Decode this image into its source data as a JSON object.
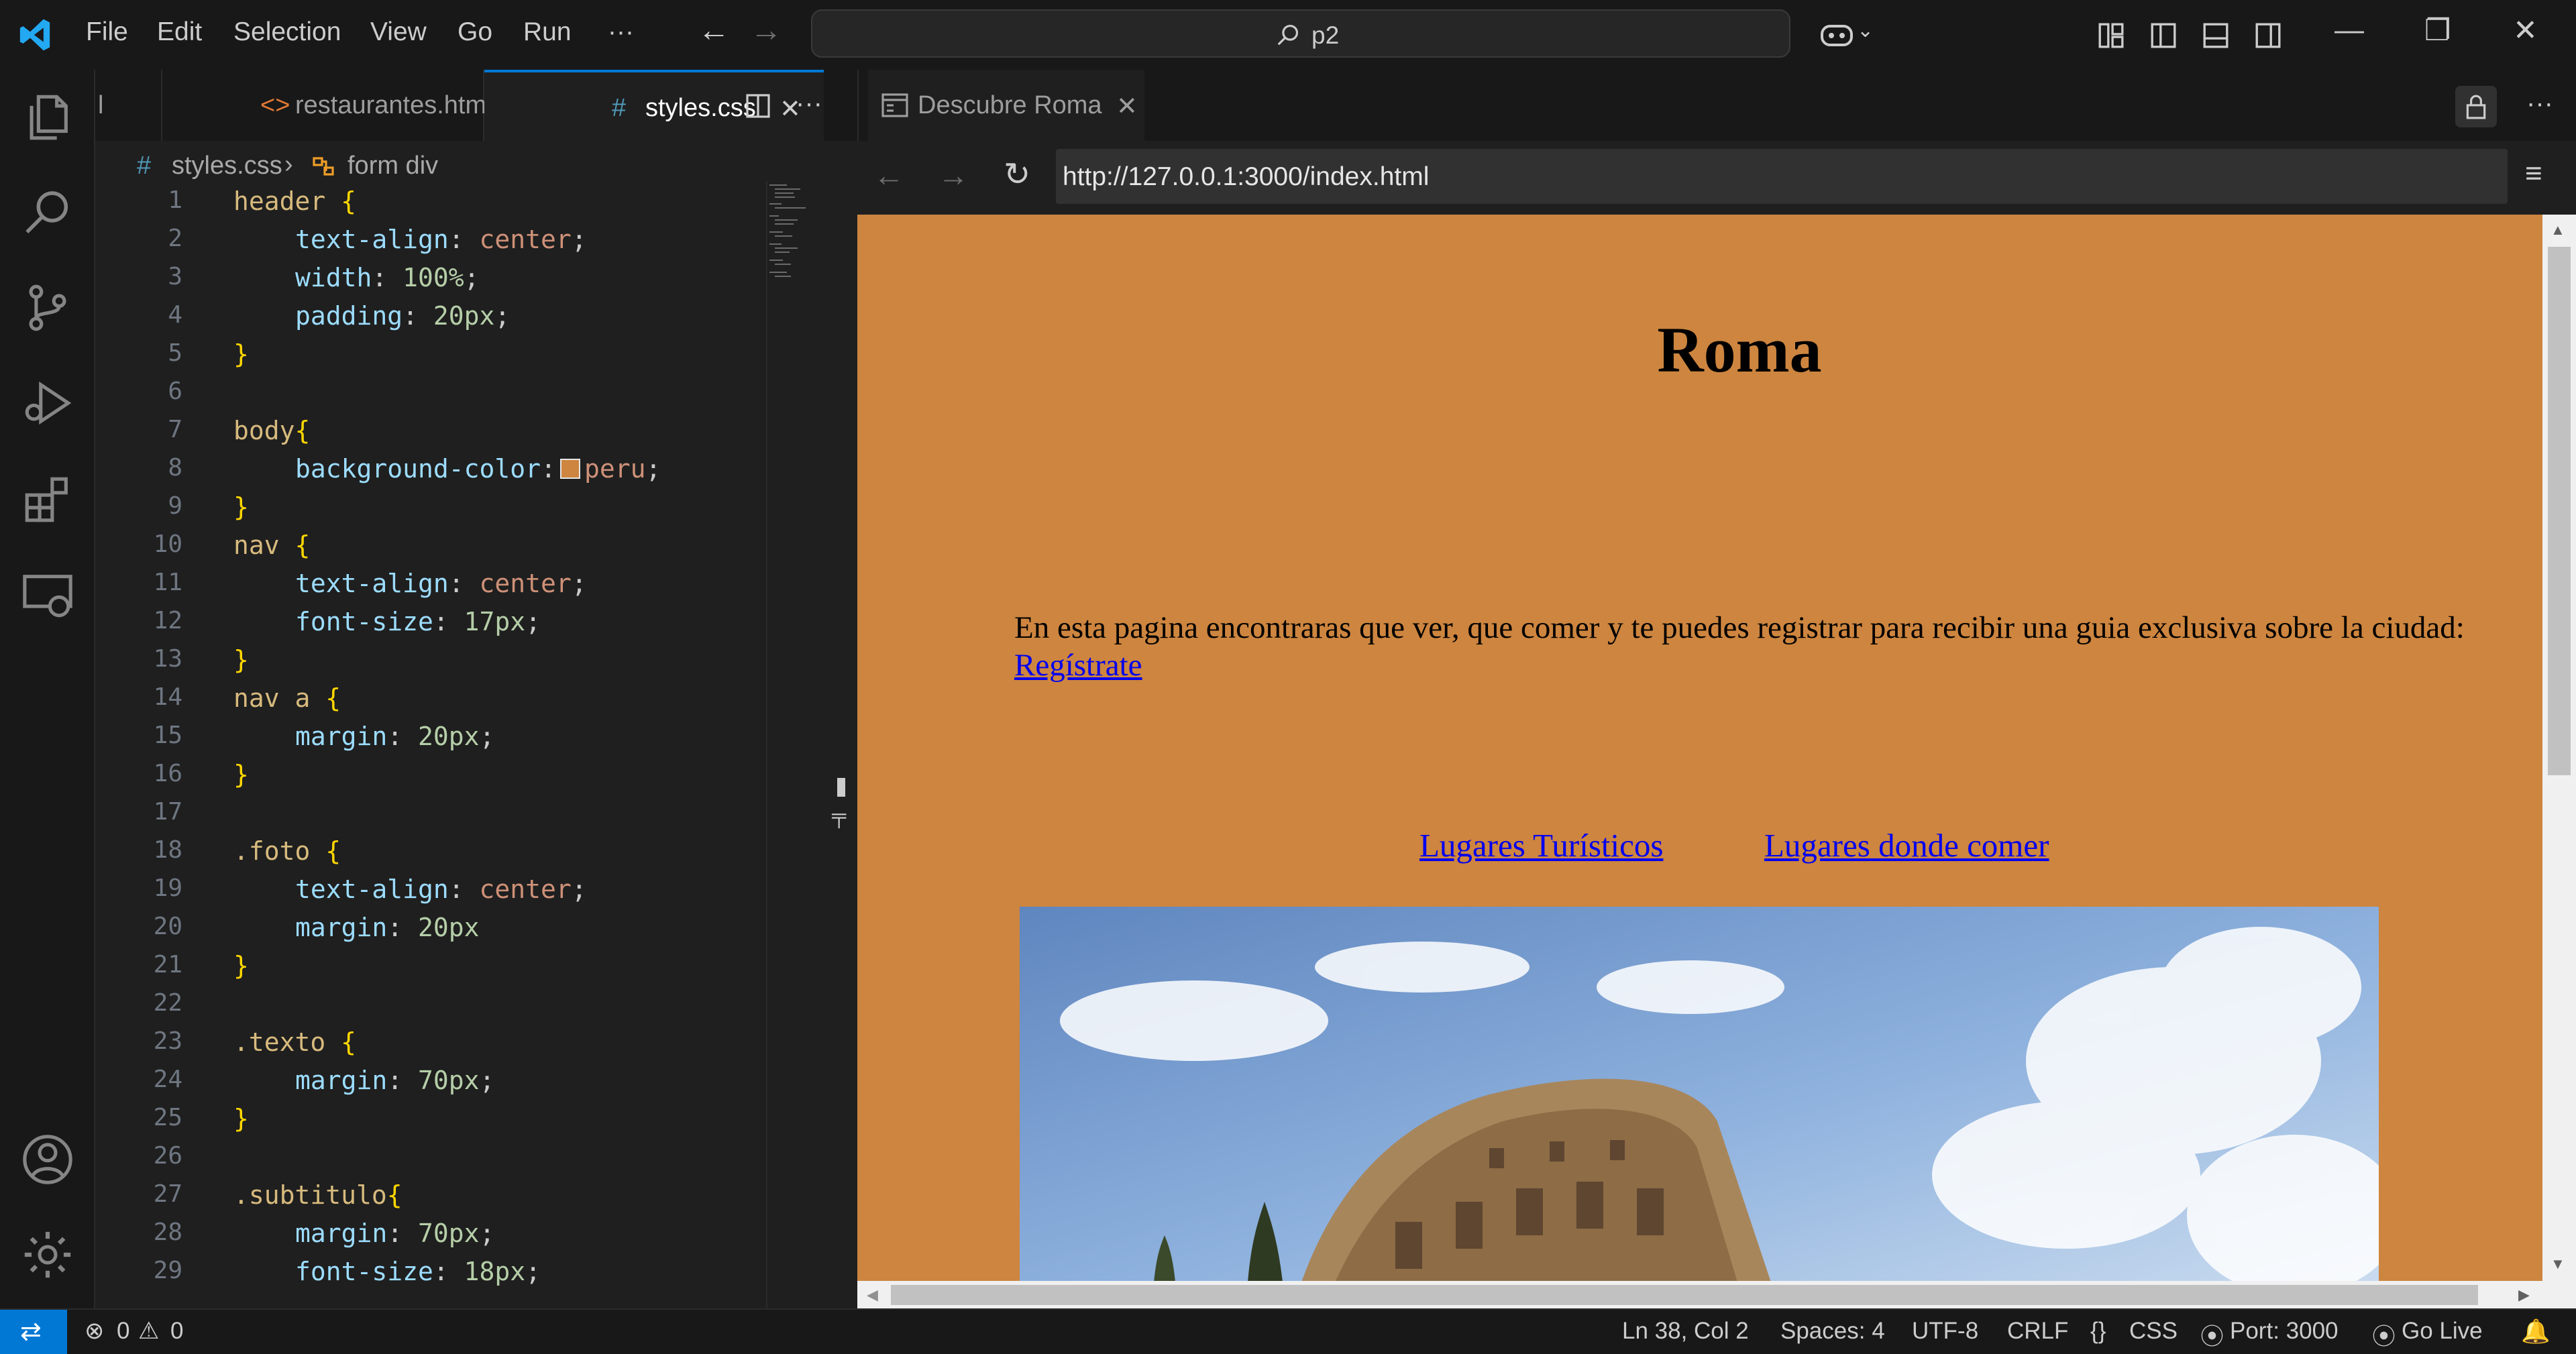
{
  "menu": [
    "File",
    "Edit",
    "Selection",
    "View",
    "Go",
    "Run",
    "···"
  ],
  "search": {
    "text": "p2"
  },
  "editor_tabs": [
    {
      "label": "l"
    },
    {
      "label": "restaurantes.html"
    },
    {
      "label": "styles.css"
    }
  ],
  "breadcrumb": {
    "file": "styles.css",
    "symbol": "form div"
  },
  "code_lines": [
    {
      "n": "1"
    },
    {
      "n": "2"
    },
    {
      "n": "3"
    },
    {
      "n": "4"
    },
    {
      "n": "5"
    },
    {
      "n": "6"
    },
    {
      "n": "7"
    },
    {
      "n": "8"
    },
    {
      "n": "9"
    },
    {
      "n": "10"
    },
    {
      "n": "11"
    },
    {
      "n": "12"
    },
    {
      "n": "13"
    },
    {
      "n": "14"
    },
    {
      "n": "15"
    },
    {
      "n": "16"
    },
    {
      "n": "17"
    },
    {
      "n": "18"
    },
    {
      "n": "19"
    },
    {
      "n": "20"
    },
    {
      "n": "21"
    },
    {
      "n": "22"
    },
    {
      "n": "23"
    },
    {
      "n": "24"
    },
    {
      "n": "25"
    },
    {
      "n": "26"
    },
    {
      "n": "27"
    },
    {
      "n": "28"
    },
    {
      "n": "29"
    }
  ],
  "code": {
    "l1": "header",
    "l2p": "text-align",
    "l2v": "center",
    "l3p": "width",
    "l3v": "100%",
    "l4p": "padding",
    "l4v": "20px",
    "l7": "body",
    "l8p": "background-color",
    "l8v": "peru",
    "l10": "nav",
    "l11p": "text-align",
    "l11v": "center",
    "l12p": "font-size",
    "l12v": "17px",
    "l14": "nav a",
    "l15p": "margin",
    "l15v": "20px",
    "l18": ".foto",
    "l19p": "text-align",
    "l19v": "center",
    "l20p": "margin",
    "l20v": "20px",
    "l23": ".texto",
    "l24p": "margin",
    "l24v": "70px",
    "l27": ".subtitulo",
    "l28p": "margin",
    "l28v": "70px",
    "l29p": "font-size",
    "l29v": "18px"
  },
  "browser": {
    "tab_title": "Descubre Roma",
    "url": "http://127.0.0.1:3000/index.html",
    "heading": "Roma",
    "paragraph": "En esta pagina encontraras que ver, que comer y te puedes registrar para recibir una guia exclusiva sobre la ciudad:",
    "register_link": " Regístrate",
    "nav_links": [
      "Lugares Turísticos",
      "Lugares donde comer"
    ]
  },
  "status": {
    "errors": "0",
    "warnings": "0",
    "position": "Ln 38, Col 2",
    "spaces": "Spaces: 4",
    "encoding": "UTF-8",
    "eol": "CRLF",
    "language": "CSS",
    "port": "Port: 3000",
    "golive": "Go Live"
  },
  "colors": {
    "accent": "#0078d4",
    "page_bg": "#cd853f",
    "link": "#0000ee"
  }
}
